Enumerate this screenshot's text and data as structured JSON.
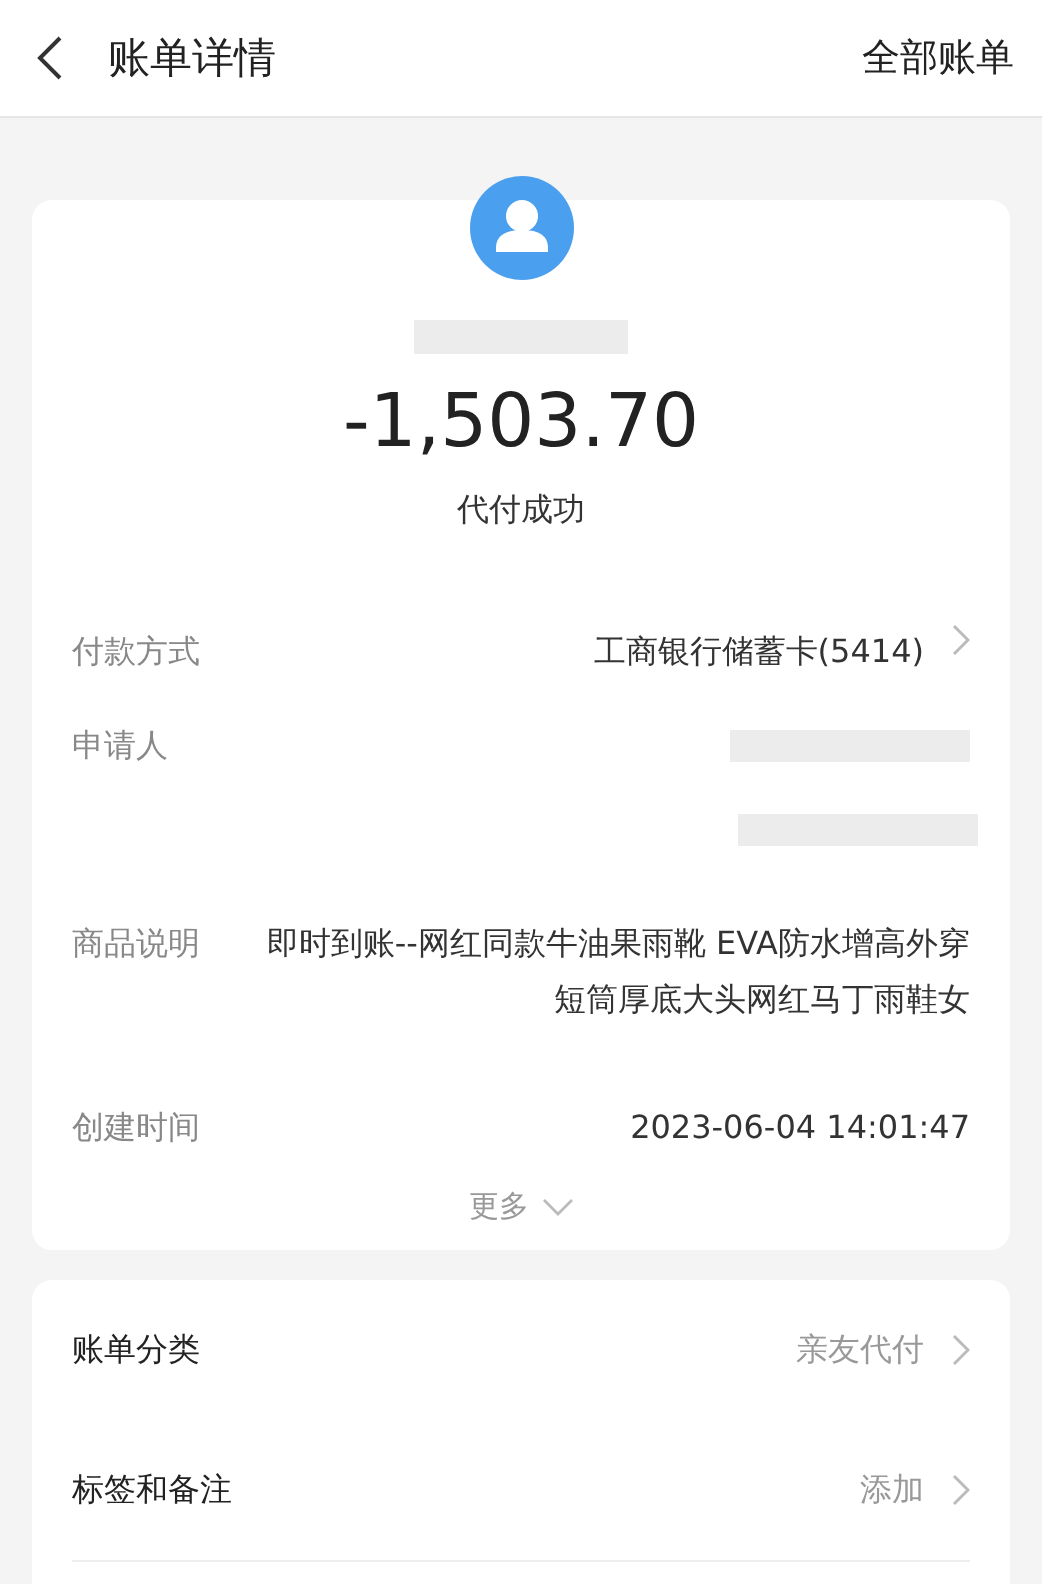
{
  "header": {
    "title": "账单详情",
    "action": "全部账单"
  },
  "summary": {
    "amount": "-1,503.70",
    "status": "代付成功"
  },
  "details": [
    {
      "kind": "link",
      "label": "付款方式",
      "value": "工商银行储蓄卡(5414)"
    },
    {
      "kind": "redacted",
      "label": "申请人"
    },
    {
      "kind": "text",
      "label": "商品说明",
      "value": "即时到账--网红同款牛油果雨靴 EVA防水增高外穿短筒厚底大头网红马丁雨鞋女"
    },
    {
      "kind": "text",
      "label": "创建时间",
      "value": "2023-06-04 14:01:47"
    }
  ],
  "more": "更多",
  "actions": [
    {
      "kind": "link",
      "label": "账单分类",
      "value": "亲友代付"
    },
    {
      "kind": "link",
      "label": "标签和备注",
      "value": "添加"
    }
  ]
}
